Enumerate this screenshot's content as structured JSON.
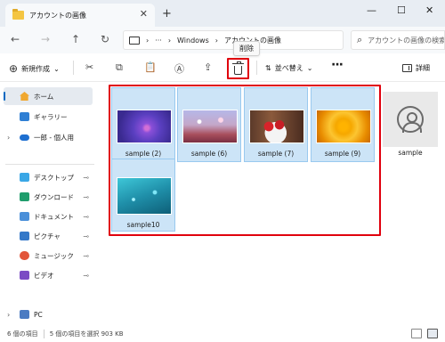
{
  "window": {
    "tab_title": "アカウントの画像",
    "new_tab": "+",
    "tab_close": "✕",
    "controls": {
      "minimize": "—",
      "maximize": "☐",
      "close": "✕"
    }
  },
  "address": {
    "back": "←",
    "forward": "→",
    "up": "↑",
    "refresh": "↻",
    "chevron": "›",
    "ellipsis": "···",
    "crumbs": [
      "Windows",
      "アカウントの画像"
    ],
    "search_placeholder": "アカウントの画像の検索"
  },
  "toolbar": {
    "new_label": "新規作成",
    "sort_label": "並べ替え",
    "more": "···",
    "details_label": "詳細",
    "delete_tooltip": "削除"
  },
  "sidebar": {
    "items": [
      {
        "label": "ホーム",
        "icon": "home-icon"
      },
      {
        "label": "ギャラリー",
        "icon": "gallery-icon"
      },
      {
        "label": "一郎 - 個人用",
        "icon": "cloud-icon"
      },
      {
        "label": "デスクトップ",
        "icon": "desktop-icon"
      },
      {
        "label": "ダウンロード",
        "icon": "download-icon"
      },
      {
        "label": "ドキュメント",
        "icon": "documents-icon"
      },
      {
        "label": "ピクチャ",
        "icon": "pictures-icon"
      },
      {
        "label": "ミュージック",
        "icon": "music-icon"
      },
      {
        "label": "ビデオ",
        "icon": "video-icon"
      },
      {
        "label": "PC",
        "icon": "pc-icon"
      }
    ],
    "chevron": "›",
    "pin": "📌"
  },
  "files": [
    {
      "name": "sample (2)",
      "selected": true
    },
    {
      "name": "sample (6)",
      "selected": true
    },
    {
      "name": "sample (7)",
      "selected": true
    },
    {
      "name": "sample (9)",
      "selected": true
    },
    {
      "name": "sample",
      "selected": false
    },
    {
      "name": "sample10",
      "selected": true
    }
  ],
  "status": {
    "count": "6 個の項目",
    "selection": "5 個の項目を選択  903 KB"
  },
  "colors": {
    "accent": "#0067c0",
    "selection_bg": "#cce4f7",
    "highlight_red": "#e0000d"
  }
}
